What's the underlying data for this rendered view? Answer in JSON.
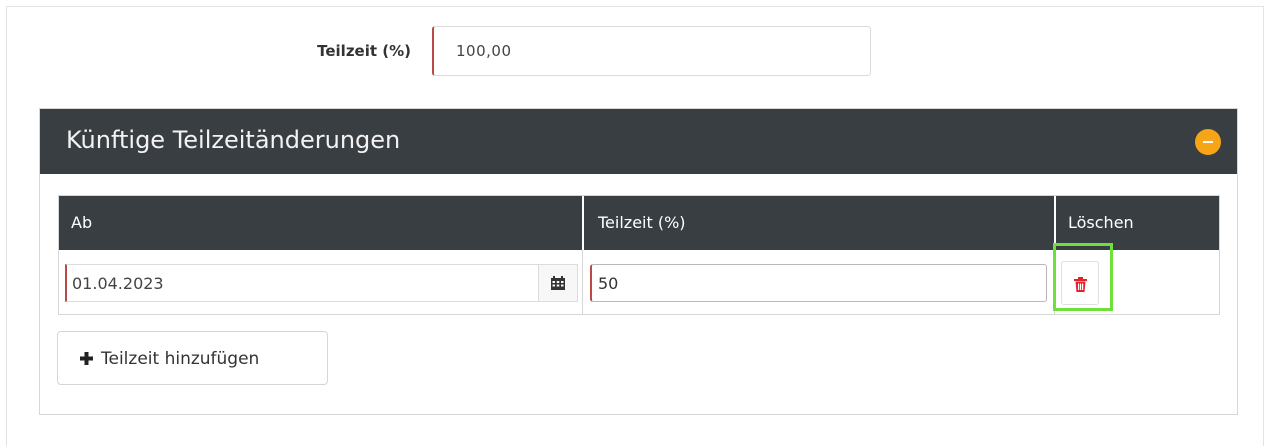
{
  "form": {
    "part_time_label": "Teilzeit (%)",
    "part_time_value": "100,00"
  },
  "panel": {
    "title": "Künftige Teilzeitänderungen",
    "collapse_icon": "minus-circle-icon",
    "accent_color": "#f6a517"
  },
  "table": {
    "columns": [
      "Ab",
      "Teilzeit (%)",
      "Löschen"
    ],
    "rows": [
      {
        "from": "01.04.2023",
        "part_time": "50",
        "delete_icon": "trash-icon"
      }
    ]
  },
  "add_button": {
    "icon": "plus-icon",
    "label": "Teilzeit hinzufügen"
  },
  "colors": {
    "header_bg": "#393e43",
    "delete_red": "#e8202a",
    "highlight_green": "#6fe03b",
    "required_border": "#b94a48"
  }
}
